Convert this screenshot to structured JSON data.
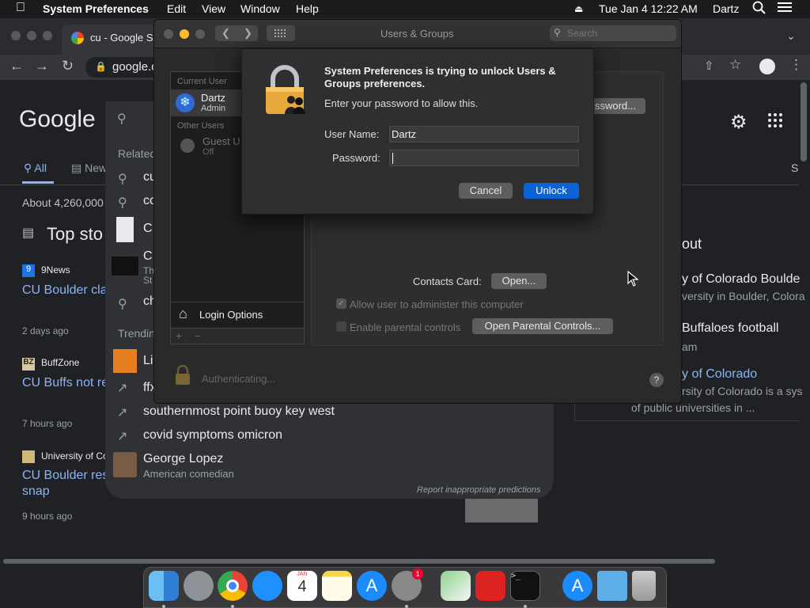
{
  "menubar": {
    "app": "System Preferences",
    "items": [
      "Edit",
      "View",
      "Window",
      "Help"
    ],
    "datetime": "Tue Jan 4  12:22 AM",
    "user": "Dartz"
  },
  "browser": {
    "tab_title": "cu - Google Se",
    "url": "google.c",
    "tabs": [
      "All",
      "New"
    ],
    "results_count": "About 4,260,000",
    "top_stories": "Top sto",
    "search_related": "Related",
    "trending": "Trendin",
    "settings_s": "S",
    "suggestions": [
      {
        "text": "cu"
      },
      {
        "text": "co"
      },
      {
        "text": "C"
      },
      {
        "text": "C",
        "sub1": "Th",
        "sub2": "St"
      },
      {
        "text": "ch"
      }
    ],
    "trend_items": [
      "Li",
      "ffx",
      "southernmost point buoy key west",
      "covid symptoms omicron"
    ],
    "person": {
      "name": "George Lopez",
      "desc": "American comedian"
    },
    "report": "Report inappropriate predictions",
    "news": [
      {
        "source": "9News",
        "title": "CU Boulder cla",
        "time": "2 days ago"
      },
      {
        "source": "BuffZone",
        "title": "CU Buffs not re",
        "time": "7 hours ago"
      },
      {
        "source": "University of Co",
        "title": "CU Boulder res",
        "title2": "snap",
        "time": "9 hours ago"
      }
    ],
    "kp": {
      "about": "out",
      "r1": "y of Colorado Boulde",
      "r1s": "versity in Boulder, Colora",
      "r2": "Buffaloes football",
      "r2s": "am",
      "r3": "y of Colorado",
      "r3s": "rsity of Colorado is a sys",
      "r3s2": "of public universities in ..."
    }
  },
  "sysprefs": {
    "title": "Users & Groups",
    "search_placeholder": "Search",
    "current_user_header": "Current User",
    "current_user_name": "Dartz",
    "current_user_role": "Admin",
    "other_users_header": "Other Users",
    "guest_name": "Guest U",
    "guest_status": "Off",
    "login_options": "Login Options",
    "change_password": "ssword...",
    "contacts_card_label": "Contacts Card:",
    "open_button": "Open...",
    "admin_checkbox": "Allow user to administer this computer",
    "parental_checkbox": "Enable parental controls",
    "parental_button": "Open Parental Controls...",
    "authenticating": "Authenticating...",
    "help": "?"
  },
  "dialog": {
    "title": "System Preferences is trying to unlock Users & Groups preferences.",
    "subtitle": "Enter your password to allow this.",
    "username_label": "User Name:",
    "username_value": "Dartz",
    "password_label": "Password:",
    "password_value": "",
    "cancel": "Cancel",
    "unlock": "Unlock"
  },
  "dock": {
    "calendar_month": "JAN",
    "calendar_day": "4",
    "badge": "1"
  },
  "colors": {
    "accent": "#0a64d8",
    "link": "#8ab4f8",
    "trafficRed": "#ff5f57",
    "trafficYellow": "#febc2e",
    "trafficGreen": "#28c840"
  }
}
